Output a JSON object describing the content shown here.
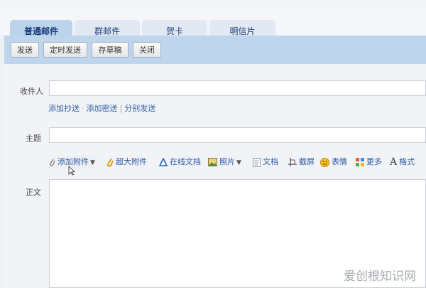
{
  "tabs": [
    {
      "label": "普通邮件"
    },
    {
      "label": "群邮件"
    },
    {
      "label": "贺卡"
    },
    {
      "label": "明信片"
    }
  ],
  "toolbar": {
    "send": "发送",
    "scheduled_send": "定时发送",
    "save_draft": "存草稿",
    "close": "关闭"
  },
  "compose": {
    "recipient_label": "收件人",
    "recipient_value": "",
    "links": {
      "add_cc": "添加抄送",
      "add_bcc": "添加密送",
      "separate_send": "分别发送"
    },
    "subject_label": "主题",
    "subject_value": "",
    "body_label": "正文",
    "body_value": ""
  },
  "attach_bar": {
    "add_attachment": "添加附件",
    "large_attachment": "超大附件",
    "online_doc": "在线文档",
    "photo": "照片",
    "document": "文档",
    "screenshot": "截屏",
    "emoji": "表情",
    "more": "更多",
    "format": "格式"
  },
  "watermark": "爱创根知识网",
  "icons": [
    "paperclip-icon",
    "large-paperclip-icon",
    "online-doc-icon",
    "photo-icon",
    "document-icon",
    "screenshot-icon",
    "emoji-icon",
    "more-icon",
    "format-icon",
    "dropdown-arrow-icon",
    "mouse-cursor-icon"
  ]
}
